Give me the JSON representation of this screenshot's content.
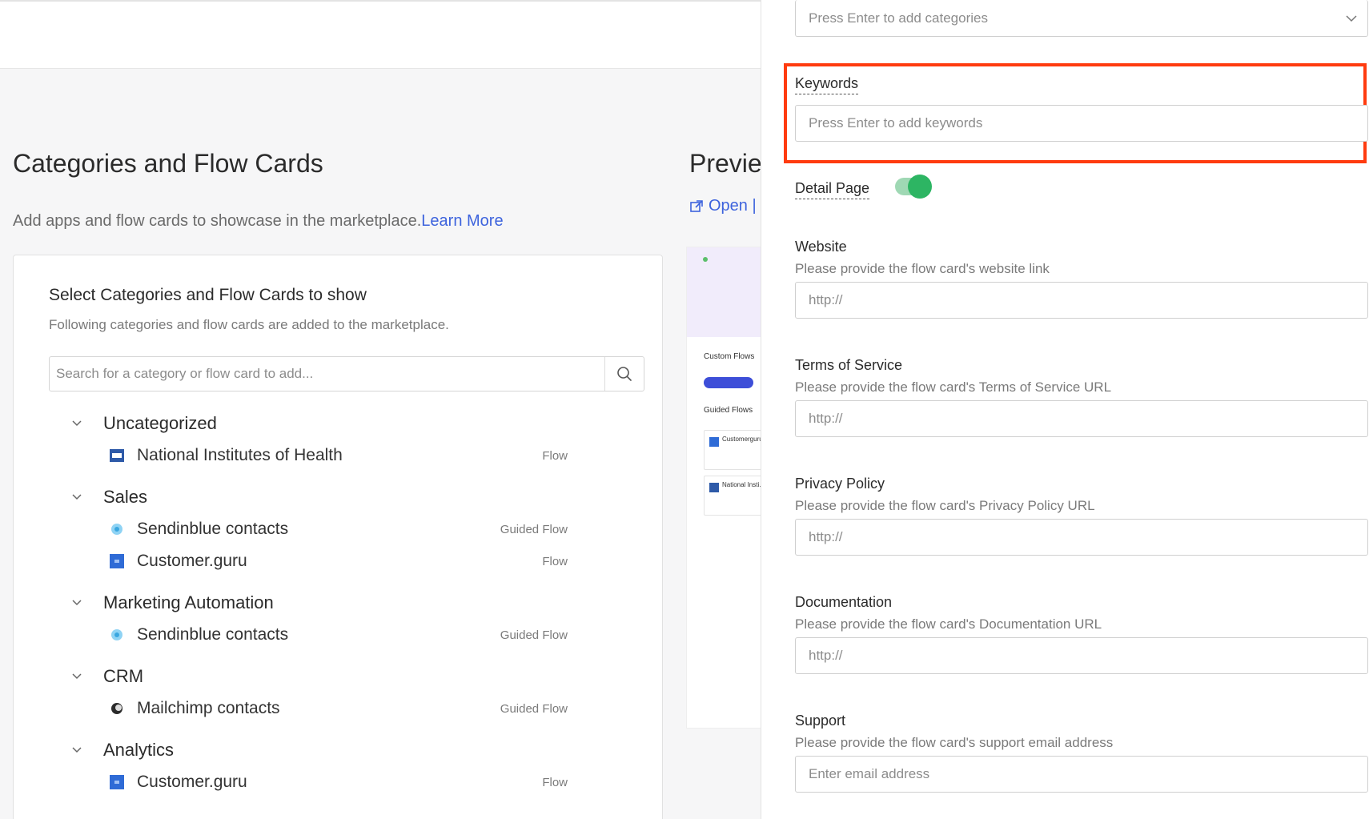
{
  "left": {
    "title": "Categories and Flow Cards",
    "description": "Add apps and flow cards to showcase in the marketplace.",
    "learn_more": "Learn More",
    "card": {
      "title": "Select Categories and Flow Cards to show",
      "subtitle": "Following categories and flow cards are added to the marketplace.",
      "search_placeholder": "Search for a category or flow card to add..."
    },
    "categories": [
      {
        "name": "Uncategorized",
        "items": [
          {
            "name": "National Institutes of Health",
            "type": "Flow",
            "icon": "nih-logo-icon"
          }
        ]
      },
      {
        "name": "Sales",
        "items": [
          {
            "name": "Sendinblue contacts",
            "type": "Guided Flow",
            "icon": "sendinblue-logo-icon"
          },
          {
            "name": "Customer.guru",
            "type": "Flow",
            "icon": "customer-guru-logo-icon"
          }
        ]
      },
      {
        "name": "Marketing Automation",
        "items": [
          {
            "name": "Sendinblue contacts",
            "type": "Guided Flow",
            "icon": "sendinblue-logo-icon"
          }
        ]
      },
      {
        "name": "CRM",
        "items": [
          {
            "name": "Mailchimp contacts",
            "type": "Guided Flow",
            "icon": "mailchimp-logo-icon"
          }
        ]
      },
      {
        "name": "Analytics",
        "items": [
          {
            "name": "Customer.guru",
            "type": "Flow",
            "icon": "customer-guru-logo-icon"
          }
        ]
      }
    ]
  },
  "preview": {
    "title": "Previe",
    "open_link": "Open |",
    "mini": {
      "custom_flows": "Custom Flows",
      "guided_flows": "Guided Flows",
      "card1": "Customerguru",
      "card2": "National Insti..."
    }
  },
  "panel": {
    "categories_placeholder": "Press Enter to add categories",
    "keywords_label": "Keywords",
    "keywords_placeholder": "Press Enter to add keywords",
    "detail_page_label": "Detail Page",
    "detail_page_enabled": true,
    "website": {
      "label": "Website",
      "helper": "Please provide the flow card's website link",
      "placeholder": "http://"
    },
    "terms": {
      "label": "Terms of Service",
      "helper": "Please provide the flow card's Terms of Service URL",
      "placeholder": "http://"
    },
    "privacy": {
      "label": "Privacy Policy",
      "helper": "Please provide the flow card's Privacy Policy URL",
      "placeholder": "http://"
    },
    "documentation": {
      "label": "Documentation",
      "helper": "Please provide the flow card's Documentation URL",
      "placeholder": "http://"
    },
    "support": {
      "label": "Support",
      "helper": "Please provide the flow card's support email address",
      "placeholder": "Enter email address"
    }
  },
  "colors": {
    "accent": "#3d63dd",
    "highlight": "#ff3b0f",
    "toggle_on": "#2db563"
  }
}
